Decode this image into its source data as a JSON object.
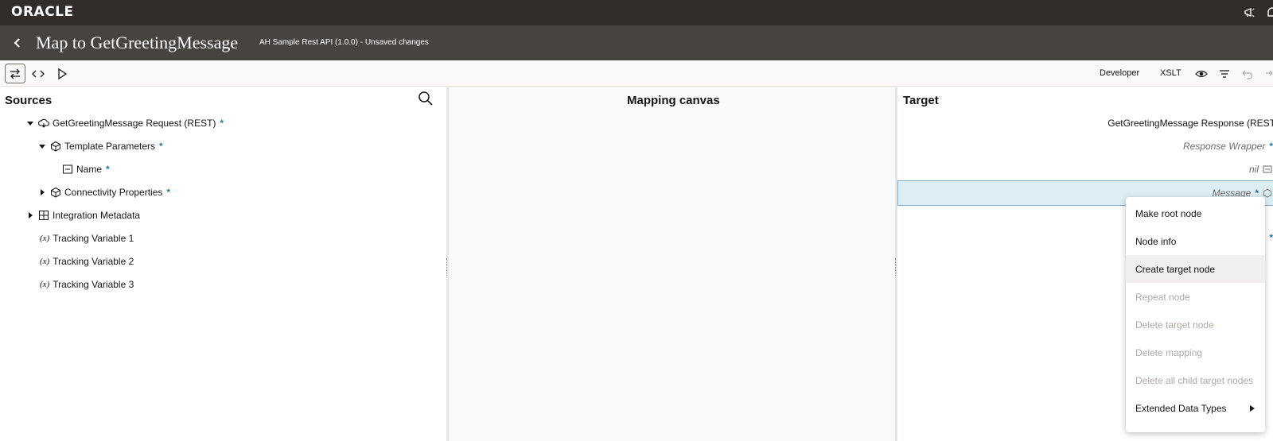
{
  "header": {
    "logo_text": "ORACLE"
  },
  "title_bar": {
    "title": "Map to GetGreetingMessage",
    "subtitle": "AH Sample Rest API (1.0.0) - Unsaved changes"
  },
  "toolbar": {
    "developer_label": "Developer",
    "xslt_label": "XSLT"
  },
  "sources": {
    "heading": "Sources",
    "required_marker": "*",
    "tree": [
      {
        "label": "GetGreetingMessage Request (REST)",
        "icon": "rest-request-icon",
        "expanded": true,
        "required": true
      },
      {
        "label": "Template Parameters",
        "icon": "object-icon",
        "expanded": true,
        "required": true
      },
      {
        "label": "Name",
        "icon": "string-field-icon",
        "required": true
      },
      {
        "label": "Connectivity Properties",
        "icon": "object-icon",
        "expanded": false,
        "required": true
      },
      {
        "label": "Integration Metadata",
        "icon": "grid-icon",
        "expanded": false,
        "required": false
      },
      {
        "label": "Tracking Variable 1",
        "icon": "variable-icon",
        "prefix": "(x)"
      },
      {
        "label": "Tracking Variable 2",
        "icon": "variable-icon",
        "prefix": "(x)"
      },
      {
        "label": "Tracking Variable 3",
        "icon": "variable-icon",
        "prefix": "(x)"
      }
    ]
  },
  "canvas": {
    "heading": "Mapping canvas"
  },
  "target": {
    "heading": "Target",
    "required_marker": "*",
    "tree": [
      {
        "label": "GetGreetingMessage Response (REST"
      },
      {
        "label": "Response Wrapper",
        "required": true
      },
      {
        "label": "nil"
      },
      {
        "label": "Message",
        "required": true,
        "selected": true
      }
    ]
  },
  "context_menu": {
    "items": [
      {
        "label": "Make root node",
        "enabled": true
      },
      {
        "label": "Node info",
        "enabled": true
      },
      {
        "label": "Create target node",
        "enabled": true,
        "hovered": true
      },
      {
        "label": "Repeat node",
        "enabled": false
      },
      {
        "label": "Delete target node",
        "enabled": false
      },
      {
        "label": "Delete mapping",
        "enabled": false
      },
      {
        "label": "Delete all child target nodes",
        "enabled": false
      },
      {
        "label": "Extended Data Types",
        "enabled": true,
        "has_submenu": true
      }
    ]
  },
  "colors": {
    "topbar": "#312d2a",
    "titlebar": "#474340",
    "required": "#227e9e",
    "selected_row": "#dceef4",
    "canvas_bg": "#f8fafb"
  }
}
